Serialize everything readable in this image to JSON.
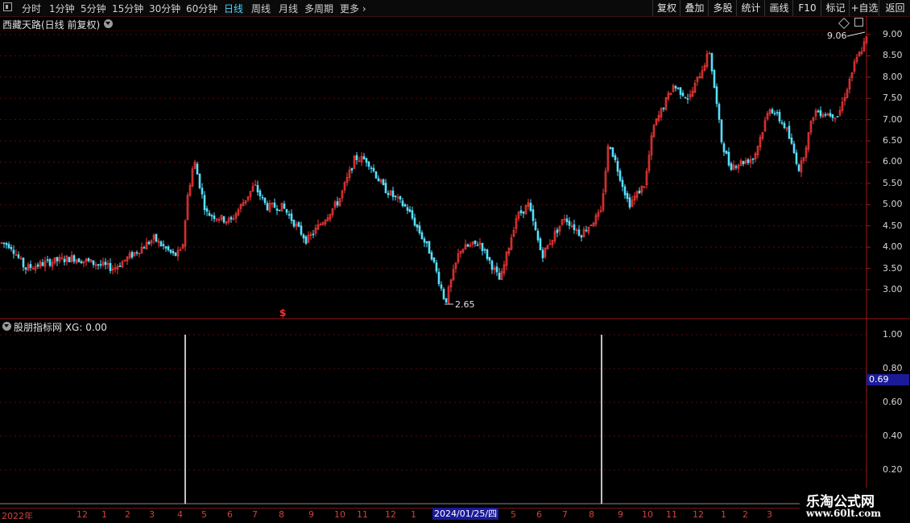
{
  "toolbar": {
    "periods": [
      {
        "label": "分时",
        "x": 27
      },
      {
        "label": "1分钟",
        "x": 61
      },
      {
        "label": "5分钟",
        "x": 100
      },
      {
        "label": "15分钟",
        "x": 139
      },
      {
        "label": "30分钟",
        "x": 185
      },
      {
        "label": "60分钟",
        "x": 231
      },
      {
        "label": "日线",
        "x": 278,
        "active": true
      },
      {
        "label": "周线",
        "x": 312
      },
      {
        "label": "月线",
        "x": 346
      },
      {
        "label": "多周期",
        "x": 378
      },
      {
        "label": "更多",
        "x": 422
      }
    ],
    "more_arrow": "›",
    "right_buttons": [
      {
        "label": "复权",
        "x": 810,
        "w": 34
      },
      {
        "label": "叠加",
        "x": 844,
        "w": 35
      },
      {
        "label": "多股",
        "x": 879,
        "w": 35
      },
      {
        "label": "统计",
        "x": 914,
        "w": 35
      },
      {
        "label": "画线",
        "x": 949,
        "w": 35
      },
      {
        "label": "F10",
        "x": 984,
        "w": 35
      },
      {
        "label": "标记",
        "x": 1019,
        "w": 35
      },
      {
        "label": "+自选",
        "x": 1054,
        "w": 37
      },
      {
        "label": "返回",
        "x": 1091,
        "w": 39
      }
    ]
  },
  "main_chart": {
    "title": "西藏天路(日线 前复权)",
    "y_ticks": [
      "9.00",
      "8.50",
      "8.00",
      "7.50",
      "7.00",
      "6.50",
      "6.00",
      "5.50",
      "5.00",
      "4.50",
      "4.00",
      "3.50",
      "3.00"
    ],
    "high_label": "9.06",
    "low_label": "2.65",
    "dollar_marker": "$",
    "colors": {
      "up": "#ff3b3b",
      "down": "#57e0ff",
      "grid": "#5a0a0a",
      "axis": "#a01818"
    }
  },
  "indicator": {
    "title": "股朋指标网 XG: 0.00",
    "y_ticks": [
      "1.00",
      "0.80",
      "0.60",
      "0.40",
      "0.20"
    ],
    "current_value": "0.69"
  },
  "date_axis": {
    "labels": [
      {
        "t": "2022年",
        "x": 2
      },
      {
        "t": "12",
        "x": 95
      },
      {
        "t": "1",
        "x": 126
      },
      {
        "t": "2",
        "x": 155
      },
      {
        "t": "3",
        "x": 185
      },
      {
        "t": "4",
        "x": 220
      },
      {
        "t": "5",
        "x": 250
      },
      {
        "t": "6",
        "x": 282
      },
      {
        "t": "7",
        "x": 313
      },
      {
        "t": "8",
        "x": 346
      },
      {
        "t": "9",
        "x": 383
      },
      {
        "t": "10",
        "x": 415
      },
      {
        "t": "11",
        "x": 443
      },
      {
        "t": "12",
        "x": 478
      },
      {
        "t": "1",
        "x": 510
      },
      {
        "t": "5",
        "x": 634
      },
      {
        "t": "6",
        "x": 666
      },
      {
        "t": "7",
        "x": 698
      },
      {
        "t": "8",
        "x": 731
      },
      {
        "t": "9",
        "x": 767
      },
      {
        "t": "10",
        "x": 797
      },
      {
        "t": "11",
        "x": 827
      },
      {
        "t": "12",
        "x": 860
      },
      {
        "t": "1",
        "x": 895
      },
      {
        "t": "2",
        "x": 922
      },
      {
        "t": "3",
        "x": 952
      }
    ],
    "cursor_date": "2024/01/25/四"
  },
  "watermark": {
    "line1": "乐淘公式网",
    "line2": "www.60lt.com"
  }
}
